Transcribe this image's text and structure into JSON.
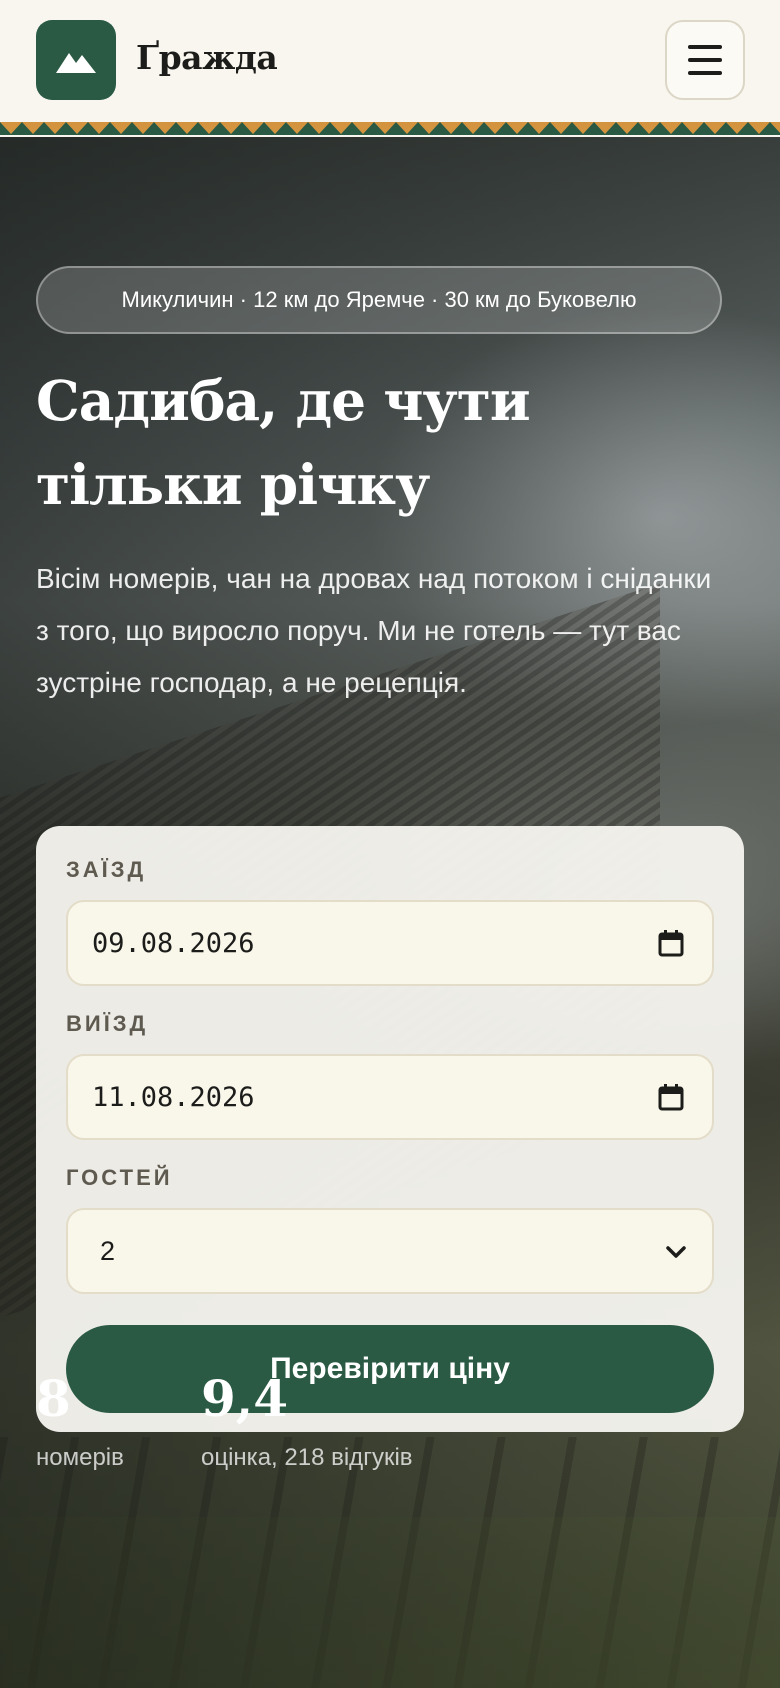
{
  "header": {
    "brand": "Ґражда",
    "logo_icon": "mountain-icon",
    "menu_icon": "hamburger-icon",
    "colors": {
      "background": "#f8f6ee",
      "accent_green": "#2b5a44",
      "ornament_orange": "#d4933f"
    }
  },
  "hero": {
    "location_pill": "Микуличин · 12 км до Яремче · 30 км до Буковелю",
    "title_line1": "Садиба, де чути",
    "title_line2": "тільки річку",
    "description": "Вісім номерів, чан на дровах над потоком і сніданки з того, що виросло поруч. Ми не готель — тут вас зустріне господар, а не рецепція."
  },
  "booking": {
    "checkin_label": "ЗАЇЗД",
    "checkin_value": "09.08.2026",
    "checkout_label": "ВИЇЗД",
    "checkout_value": "11.08.2026",
    "guests_label": "ГОСТЕЙ",
    "guests_value": "2",
    "submit_label": "Перевірити ціну"
  },
  "stats": [
    {
      "value": "8",
      "label": "номерів"
    },
    {
      "value": "9,4",
      "label": "оцінка, 218 відгуків"
    }
  ]
}
